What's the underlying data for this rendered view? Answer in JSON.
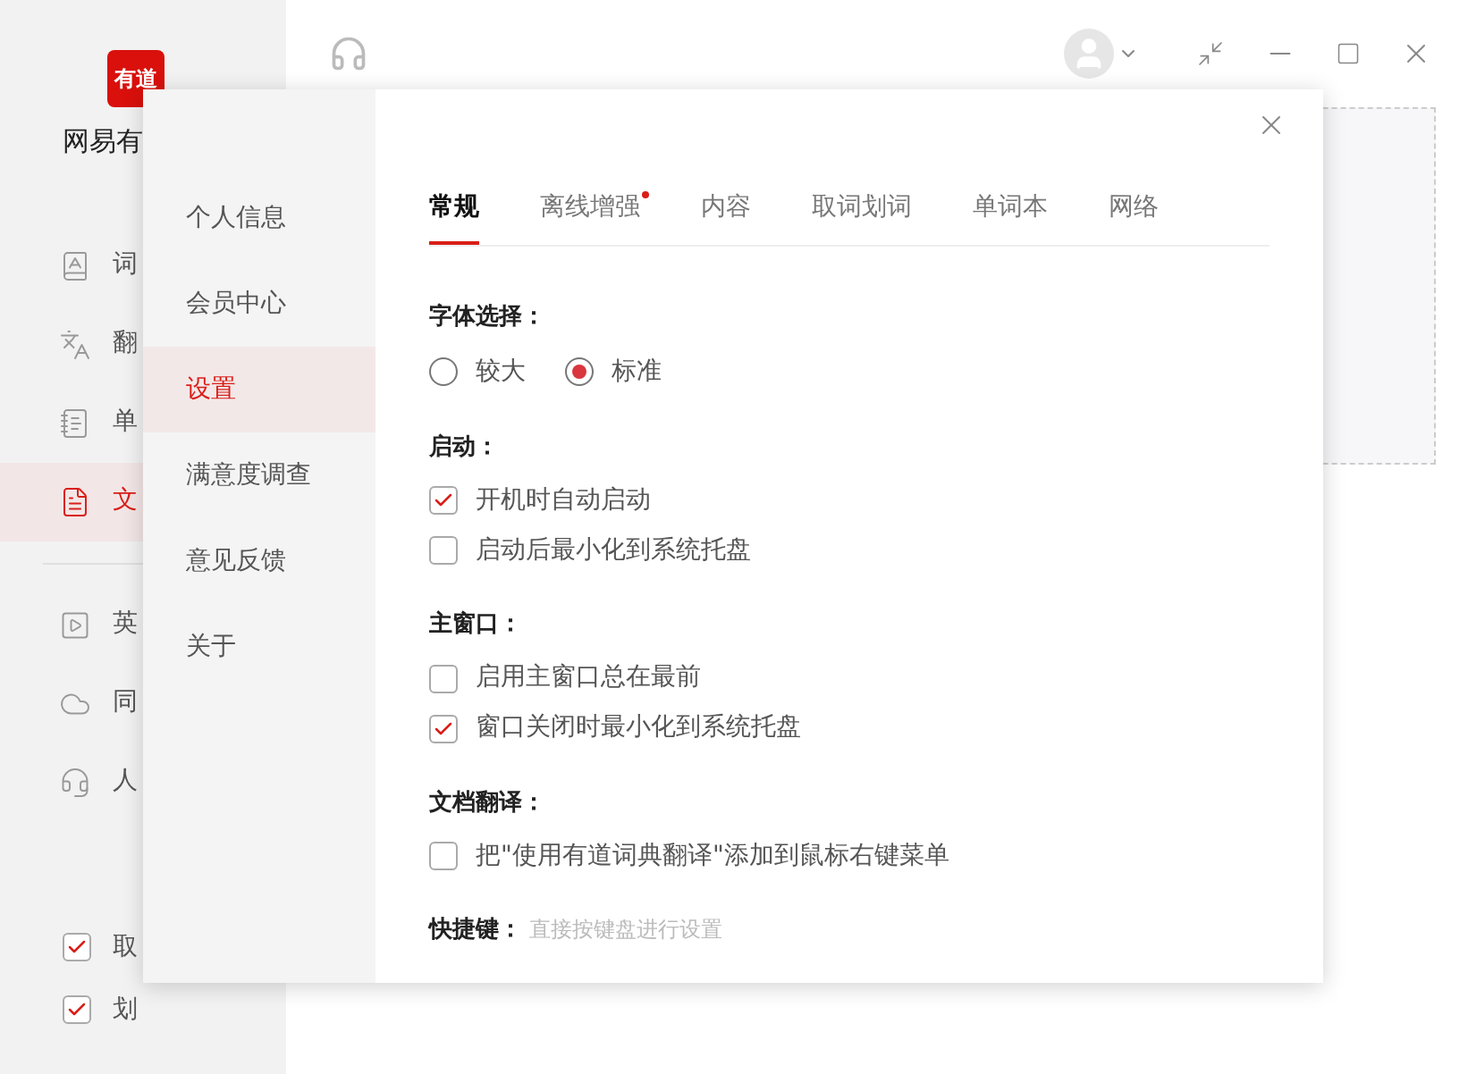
{
  "app": {
    "logo": "有道",
    "name": "网易有",
    "nav_top": [
      {
        "label": "词",
        "kind": "dictionary",
        "selected": false
      },
      {
        "label": "翻",
        "kind": "translation",
        "selected": false
      },
      {
        "label": "单",
        "kind": "wordbook",
        "selected": false
      },
      {
        "label": "文",
        "kind": "document",
        "selected": true
      }
    ],
    "nav_bottom": [
      {
        "label": "英",
        "kind": "video",
        "selected": false
      },
      {
        "label": "同",
        "kind": "cloud",
        "selected": false
      },
      {
        "label": "人",
        "kind": "human",
        "selected": false
      }
    ],
    "toggles": [
      {
        "label": "取",
        "checked": true
      },
      {
        "label": "划",
        "checked": true
      }
    ]
  },
  "settings": {
    "menu": [
      {
        "label": "个人信息",
        "selected": false
      },
      {
        "label": "会员中心",
        "selected": false
      },
      {
        "label": "设置",
        "selected": true
      },
      {
        "label": "满意度调查",
        "selected": false
      },
      {
        "label": "意见反馈",
        "selected": false
      },
      {
        "label": "关于",
        "selected": false
      }
    ],
    "tabs": [
      {
        "label": "常规",
        "selected": true,
        "badge": false
      },
      {
        "label": "离线增强",
        "selected": false,
        "badge": true
      },
      {
        "label": "内容",
        "selected": false,
        "badge": false
      },
      {
        "label": "取词划词",
        "selected": false,
        "badge": false
      },
      {
        "label": "单词本",
        "selected": false,
        "badge": false
      },
      {
        "label": "网络",
        "selected": false,
        "badge": false
      }
    ],
    "sections": [
      {
        "title": "字体选择：",
        "kind": "radio",
        "options": [
          {
            "label": "较大",
            "selected": false
          },
          {
            "label": "标准",
            "selected": true
          }
        ]
      },
      {
        "title": "启动：",
        "kind": "checkbox",
        "options": [
          {
            "label": "开机时自动启动",
            "checked": true
          },
          {
            "label": "启动后最小化到系统托盘",
            "checked": false
          }
        ]
      },
      {
        "title": "主窗口：",
        "kind": "checkbox",
        "options": [
          {
            "label": "启用主窗口总在最前",
            "checked": false
          },
          {
            "label": "窗口关闭时最小化到系统托盘",
            "checked": true
          }
        ]
      },
      {
        "title": "文档翻译：",
        "kind": "checkbox",
        "options": [
          {
            "label": "把\"使用有道词典翻译\"添加到鼠标右键菜单",
            "checked": false
          }
        ]
      },
      {
        "title": "快捷键：",
        "kind": "hint",
        "hint": "直接按键盘进行设置"
      }
    ]
  }
}
